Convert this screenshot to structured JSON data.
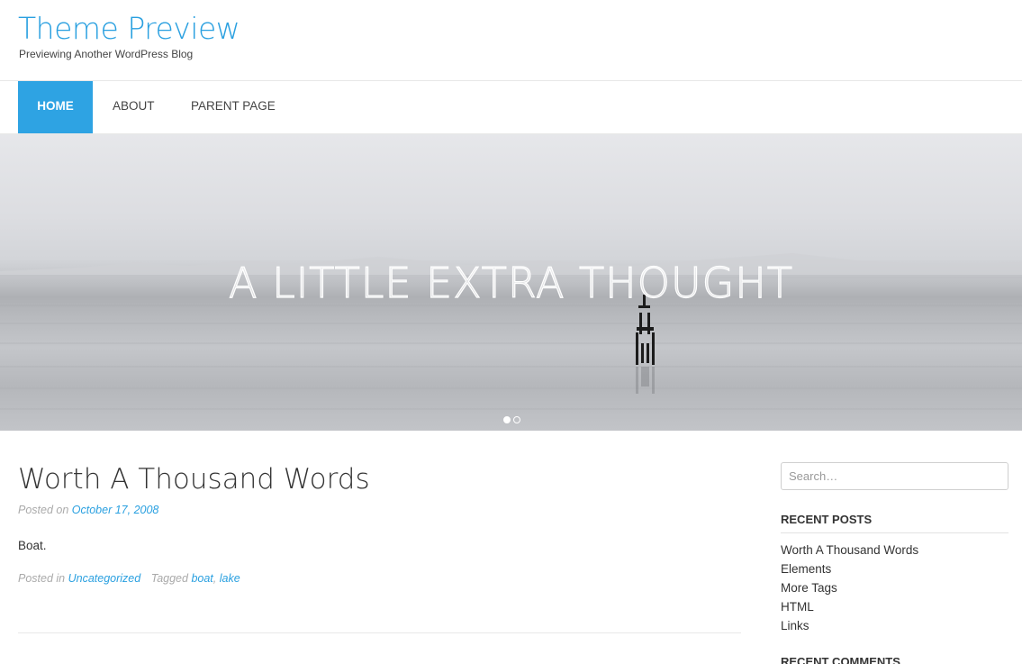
{
  "site": {
    "title": "Theme Preview",
    "description": "Previewing Another WordPress Blog"
  },
  "nav": {
    "items": [
      {
        "label": "HOME",
        "active": true
      },
      {
        "label": "ABOUT",
        "active": false
      },
      {
        "label": "PARENT PAGE",
        "active": false
      }
    ]
  },
  "hero": {
    "title": "A LITTLE EXTRA THOUGHT",
    "slides_total": 2,
    "active_slide": 1
  },
  "post": {
    "title": "Worth A Thousand Words",
    "posted_on_label": "Posted on",
    "date": "October 17, 2008",
    "content": "Boat.",
    "posted_in_label": "Posted in",
    "category": "Uncategorized",
    "tagged_label": "Tagged",
    "tags": [
      "boat",
      "lake"
    ],
    "tag_separator": ", "
  },
  "sidebar": {
    "search_placeholder": "Search…",
    "recent_posts_title": "RECENT POSTS",
    "recent_posts": [
      "Worth A Thousand Words",
      "Elements",
      "More Tags",
      "HTML",
      "Links"
    ],
    "recent_comments_title": "RECENT COMMENTS"
  },
  "colors": {
    "accent": "#2ea3e3",
    "link": "#2aa0e0",
    "meta_text": "#aaaaaa"
  }
}
